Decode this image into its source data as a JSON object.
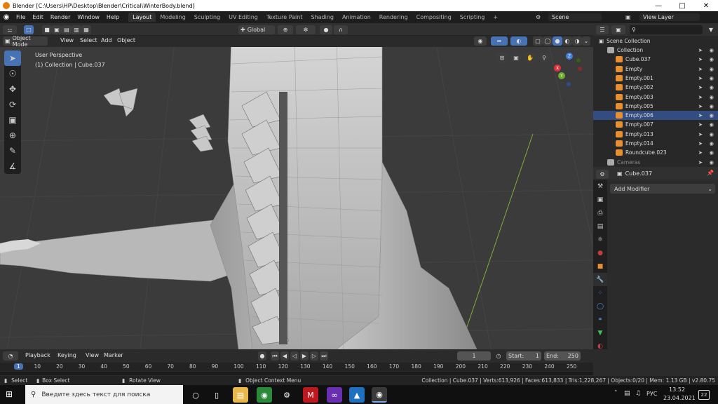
{
  "window": {
    "title": "Blender [C:\\Users\\HP\\Desktop\\Blender\\Critical\\WinterBody.blend]"
  },
  "topbar": {
    "menu": [
      "File",
      "Edit",
      "Render",
      "Window",
      "Help"
    ],
    "tabs": [
      "Layout",
      "Modeling",
      "Sculpting",
      "UV Editing",
      "Texture Paint",
      "Shading",
      "Animation",
      "Rendering",
      "Compositing",
      "Scripting"
    ],
    "active_tab": "Layout",
    "scene": "Scene",
    "view_layer": "View Layer"
  },
  "viewport_header": {
    "transform_orientation": "Global",
    "mode": "Object Mode",
    "menu": [
      "View",
      "Select",
      "Add",
      "Object"
    ]
  },
  "viewport": {
    "perspective": "User Perspective",
    "collection_info": "(1) Collection | Cube.037",
    "gizmo_axes": [
      "X",
      "Y",
      "Z"
    ]
  },
  "outliner": {
    "root": "Scene Collection",
    "items": [
      {
        "name": "Collection",
        "indent": 1
      },
      {
        "name": "Cube.037",
        "indent": 2,
        "type": "mesh"
      },
      {
        "name": "Empty",
        "indent": 2,
        "type": "empty"
      },
      {
        "name": "Empty.001",
        "indent": 2,
        "type": "empty"
      },
      {
        "name": "Empty.002",
        "indent": 2,
        "type": "empty"
      },
      {
        "name": "Empty.003",
        "indent": 2,
        "type": "empty"
      },
      {
        "name": "Empty.005",
        "indent": 2,
        "type": "empty"
      },
      {
        "name": "Empty.006",
        "indent": 2,
        "type": "empty",
        "selected": true
      },
      {
        "name": "Empty.007",
        "indent": 2,
        "type": "empty"
      },
      {
        "name": "Empty.013",
        "indent": 2,
        "type": "empty"
      },
      {
        "name": "Empty.014",
        "indent": 2,
        "type": "empty"
      },
      {
        "name": "Roundcube.023",
        "indent": 2,
        "type": "mesh"
      },
      {
        "name": "Cameras",
        "indent": 1,
        "dim": true
      }
    ]
  },
  "properties": {
    "object_name": "Cube.037",
    "add_modifier": "Add Modifier"
  },
  "timeline": {
    "menu": [
      "Playback",
      "Keying",
      "View",
      "Marker"
    ],
    "current_frame": "1",
    "start_label": "Start:",
    "start": "1",
    "end_label": "End:",
    "end": "250",
    "ticks": [
      "1",
      "10",
      "20",
      "30",
      "40",
      "50",
      "60",
      "70",
      "80",
      "90",
      "100",
      "110",
      "120",
      "130",
      "140",
      "150",
      "160",
      "170",
      "180",
      "190",
      "200",
      "210",
      "220",
      "230",
      "240",
      "250"
    ]
  },
  "statusbar": {
    "select": "Select",
    "box_select": "Box Select",
    "rotate_view": "Rotate View",
    "context_menu": "Object Context Menu",
    "stats": "Collection | Cube.037 | Verts:613,926 | Faces:613,833 | Tris:1,228,267 | Objects:0/20 | Mem: 1.13 GB | v2.80.75"
  },
  "taskbar": {
    "search_placeholder": "Введите здесь текст для поиска",
    "lang": "РУС",
    "time": "13:52",
    "date": "23.04.2021",
    "notifications": "22"
  },
  "colors": {
    "accent": "#4772b3",
    "selection": "#334d80",
    "x_axis": "#e0303f",
    "y_axis": "#6fae2a",
    "z_axis": "#3f7fe0"
  }
}
